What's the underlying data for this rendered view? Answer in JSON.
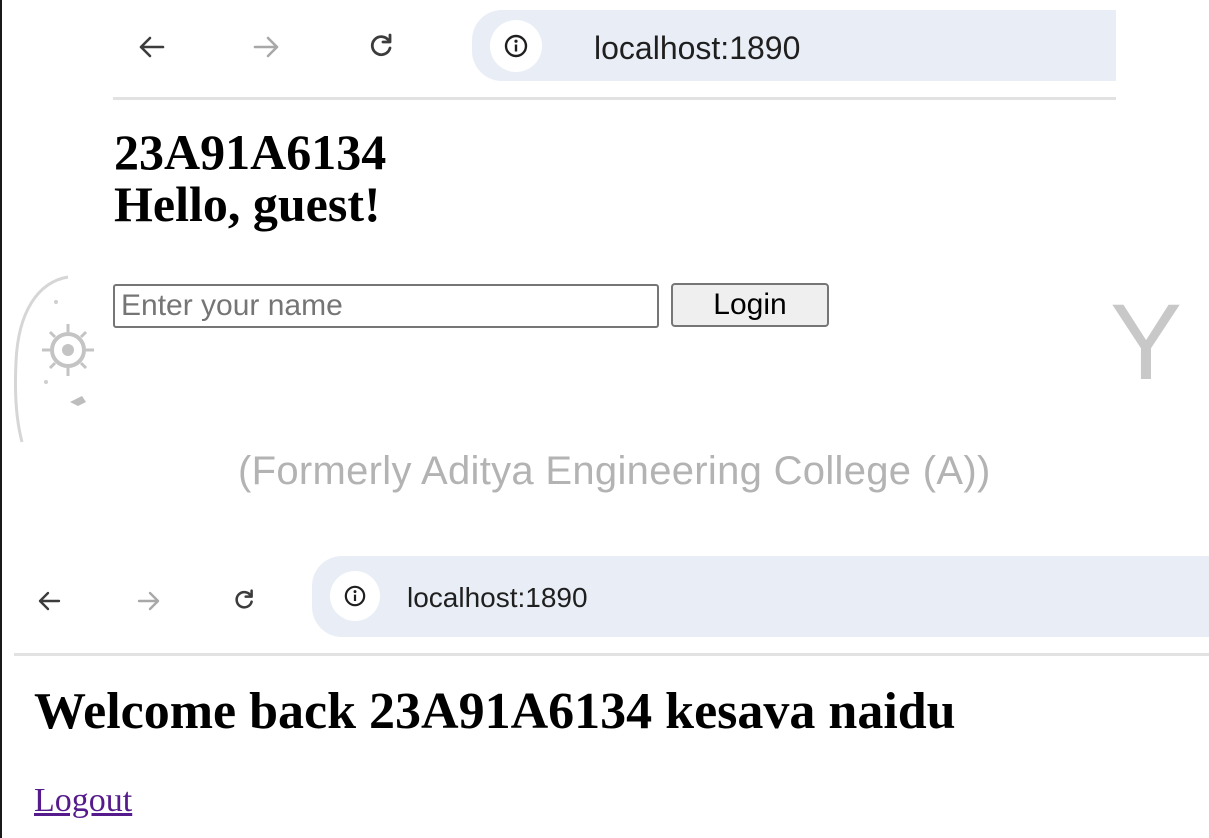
{
  "top_browser": {
    "url": "localhost:1890",
    "icons": {
      "back": "arrow-left-icon",
      "forward": "arrow-right-icon",
      "reload": "reload-icon",
      "site_info": "info-icon"
    }
  },
  "top_page": {
    "roll_number": "23A91A6134",
    "greeting": "Hello, guest!",
    "name_input": {
      "placeholder": "Enter your name",
      "value": ""
    },
    "login_label": "Login"
  },
  "background": {
    "big_letter": "Y",
    "subtitle": "(Formerly Aditya Engineering College (A))"
  },
  "bottom_browser": {
    "url": "localhost:1890",
    "icons": {
      "back": "arrow-left-icon",
      "forward": "arrow-right-icon",
      "reload": "reload-icon",
      "site_info": "info-icon"
    }
  },
  "bottom_page": {
    "welcome": "Welcome back 23A91A6134 kesava naidu",
    "logout_label": "Logout"
  },
  "colors": {
    "urlbar_bg": "#e9eef6",
    "link_visited": "#551a8b",
    "disabled_icon": "#a8a8a8",
    "icon": "#3c3c3c"
  }
}
